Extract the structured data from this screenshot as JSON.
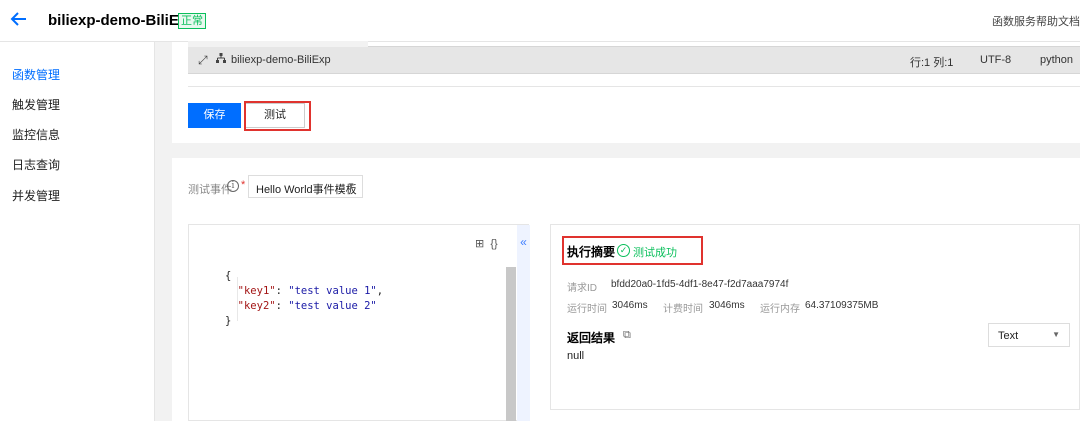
{
  "header": {
    "back_icon": "arrow-left-icon",
    "title": "biliexp-demo-BiliExp",
    "status": "正常",
    "help_link": "函数服务帮助文档"
  },
  "sidebar": {
    "items": [
      {
        "label": "函数管理",
        "active": true
      },
      {
        "label": "触发管理",
        "active": false
      },
      {
        "label": "监控信息",
        "active": false
      },
      {
        "label": "日志查询",
        "active": false
      },
      {
        "label": "并发管理",
        "active": false
      }
    ]
  },
  "editor_status": {
    "file_name": "biliexp-demo-BiliExp",
    "cursor": "行:1 列:1",
    "encoding": "UTF-8",
    "language": "python"
  },
  "actions": {
    "save_label": "保存",
    "test_label": "测试"
  },
  "test_event": {
    "label": "测试事件",
    "required_mark": "*",
    "selected": "Hello World事件模板"
  },
  "code": {
    "open": "{",
    "key1": "\"key1\"",
    "val1": "\"test value 1\"",
    "key2": "\"key2\"",
    "val2": "\"test value 2\"",
    "close": "}"
  },
  "summary": {
    "title": "执行摘要",
    "status": "测试成功",
    "request_id_label": "请求ID",
    "request_id": "bfdd20a0-1fd5-4df1-8e47-f2d7aaa7974f",
    "run_time_label": "运行时间",
    "run_time": "3046ms",
    "billed_time_label": "计费时间",
    "billed_time": "3046ms",
    "memory_label": "运行内存",
    "memory": "64.37109375MB"
  },
  "result": {
    "title": "返回结果",
    "value": "null",
    "format": "Text"
  },
  "colors": {
    "accent": "#006eff",
    "success": "#0abf5b",
    "highlight": "#e0332e"
  }
}
